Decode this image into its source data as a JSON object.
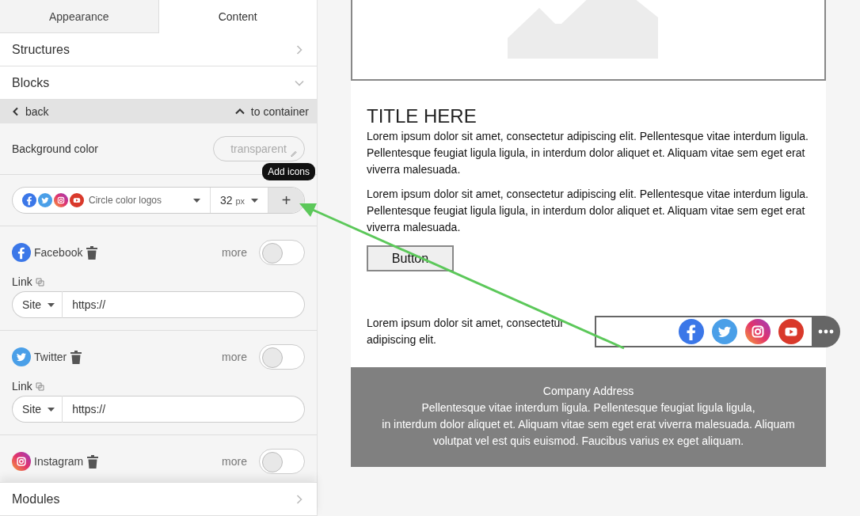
{
  "tabs": [
    {
      "label": "Appearance",
      "selected": false
    },
    {
      "label": "Content",
      "selected": true
    }
  ],
  "sections": [
    {
      "label": "Structures",
      "expanded": false
    },
    {
      "label": "Blocks",
      "expanded": true
    }
  ],
  "nav": {
    "back": "back",
    "up": "to container"
  },
  "background_color": {
    "label": "Background color",
    "value": "transparent"
  },
  "icon_set": {
    "icons": [
      {
        "kind": "facebook"
      },
      {
        "kind": "twitter"
      },
      {
        "kind": "instagram"
      },
      {
        "kind": "youtube"
      }
    ],
    "style": "Circle color logos",
    "size": "32",
    "unit": "px",
    "tooltip": "Add icons",
    "add": "+"
  },
  "networks": [
    {
      "kind": "facebook",
      "name": "Facebook",
      "more": "more",
      "more_on": false,
      "link": {
        "label": "Link",
        "type": "Site",
        "url": "https://"
      }
    },
    {
      "kind": "twitter",
      "name": "Twitter",
      "more": "more",
      "more_on": false,
      "link": {
        "label": "Link",
        "type": "Site",
        "url": "https://"
      }
    },
    {
      "kind": "instagram",
      "name": "Instagram",
      "more": "more",
      "more_on": false
    }
  ],
  "modules": {
    "label": "Modules",
    "expanded": false
  },
  "email": {
    "title": "TITLE HERE",
    "paragraphs": [
      "Lorem ipsum dolor sit amet, consectetur adipiscing elit. Pellentesque vitae interdum ligula. Pellentesque feugiat ligula ligula, in interdum dolor aliquet et. Aliquam vitae sem eget erat viverra malesuada.",
      "Lorem ipsum dolor sit amet, consectetur adipiscing elit. Pellentesque vitae interdum ligula. Pellentesque feugiat ligula ligula, in interdum dolor aliquet et. Aliquam vitae sem eget erat viverra malesuada."
    ],
    "button": "Button",
    "social_text": "Lorem ipsum dolor sit amet, consectetur adipiscing elit.",
    "social_icons": [
      {
        "kind": "facebook"
      },
      {
        "kind": "twitter"
      },
      {
        "kind": "instagram"
      },
      {
        "kind": "youtube"
      }
    ],
    "footer": [
      "Company Address",
      "Pellentesque vitae interdum ligula. Pellentesque feugiat ligula ligula,",
      "in interdum dolor aliquet et. Aliquam vitae sem eget erat viverra malesuada. Aliquam",
      "volutpat vel est quis euismod. Faucibus varius ex eget aliquam."
    ]
  }
}
